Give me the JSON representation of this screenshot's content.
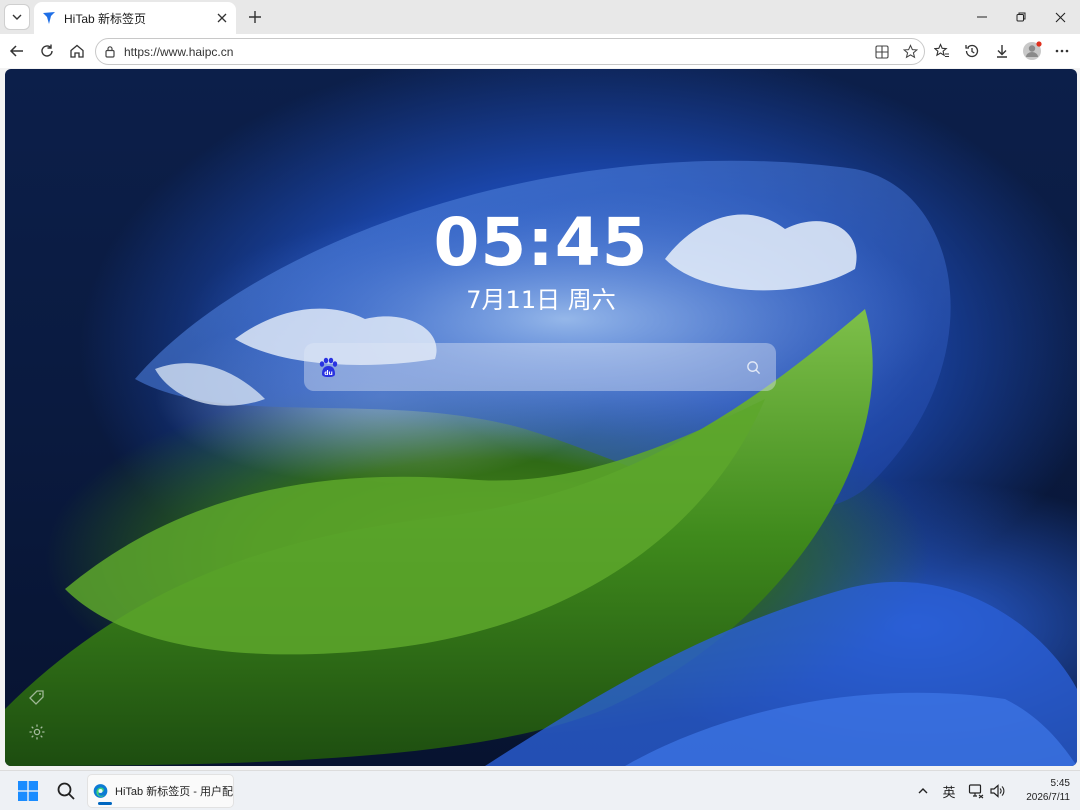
{
  "browser": {
    "tab": {
      "title": "HiTab 新标签页"
    },
    "address": {
      "url": "https://www.haipc.cn"
    }
  },
  "page": {
    "clock": "05:45",
    "date": "7月11日 周六",
    "search": {
      "engine_icon": "baidu-du-icon",
      "placeholder": ""
    }
  },
  "taskbar": {
    "app_label": "HiTab 新标签页 - 用户配",
    "ime": "英",
    "time": "5:45",
    "date": "2026/7/11"
  },
  "colors": {
    "accent": "#0067c0",
    "favicon": "#1f6fe6",
    "baidu": "#2932e1"
  }
}
